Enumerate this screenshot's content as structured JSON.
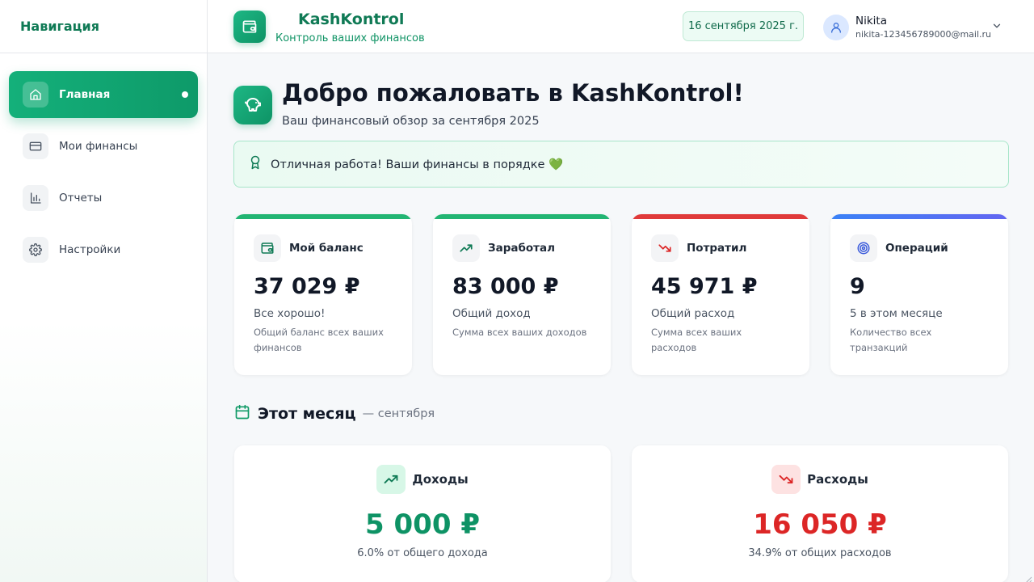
{
  "sidebar": {
    "title": "Навигация",
    "items": [
      {
        "label": "Главная",
        "icon": "home-icon",
        "active": true
      },
      {
        "label": "Мои финансы",
        "icon": "credit-card-icon"
      },
      {
        "label": "Отчеты",
        "icon": "bar-chart-icon"
      },
      {
        "label": "Настройки",
        "icon": "gear-icon"
      }
    ]
  },
  "header": {
    "brand_name": "KashKontrol",
    "brand_subtitle": "Контроль ваших финансов",
    "date": "16 сентября 2025 г.",
    "user": {
      "name": "Nikita",
      "email": "nikita-123456789000@mail.ru"
    }
  },
  "welcome": {
    "title": "Добро пожаловать в KashKontrol!",
    "subtitle": "Ваш финансовый обзор за сентября 2025",
    "banner": "Отличная работа! Ваши финансы в порядке 💚"
  },
  "stats": [
    {
      "title": "Мой баланс",
      "value": "37 029 ₽",
      "status": "Все хорошо!",
      "desc": "Общий баланс всех ваших финансов",
      "color": "#22b573",
      "icon": "wallet-icon"
    },
    {
      "title": "Заработал",
      "value": "83 000 ₽",
      "status": "Общий доход",
      "desc": "Сумма всех ваших доходов",
      "color": "#22b573",
      "icon": "trending-up-icon"
    },
    {
      "title": "Потратил",
      "value": "45 971 ₽",
      "status": "Общий расход",
      "desc": "Сумма всех ваших расходов",
      "color": "#e03a3a",
      "icon": "trending-down-icon"
    },
    {
      "title": "Операций",
      "value": "9",
      "status": "5 в этом месяце",
      "desc": "Количество всех транзакций",
      "color": "#4f6fe8",
      "icon": "target-icon"
    }
  ],
  "month": {
    "title": "Этот месяц",
    "subtitle": "— сентября",
    "income": {
      "title": "Доходы",
      "value": "5 000 ₽",
      "note": "6.0% от общего дохода",
      "color": "#0e9365"
    },
    "expense": {
      "title": "Расходы",
      "value": "16 050 ₽",
      "note": "34.9% от общих расходов",
      "color": "#dc2626"
    }
  }
}
